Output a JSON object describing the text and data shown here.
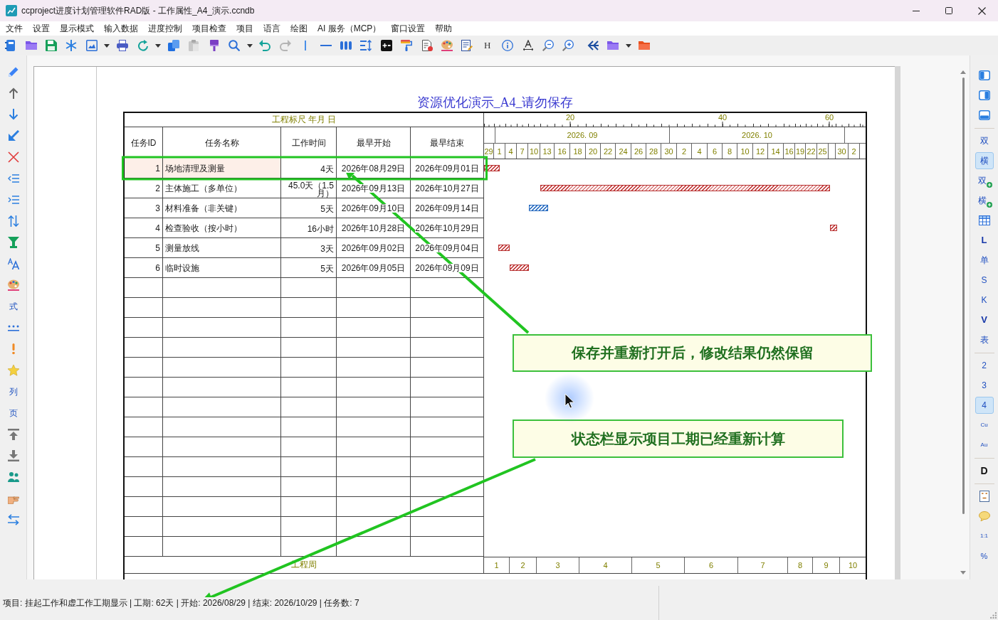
{
  "window": {
    "title": "ccproject进度计划管理软件RAD版 - 工作属性_A4_演示.ccndb"
  },
  "menu": [
    "文件",
    "设置",
    "显示模式",
    "输入数据",
    "进度控制",
    "项目检查",
    "项目",
    "语言",
    "绘图",
    "AI 服务（MCP）",
    "窗口设置",
    "帮助"
  ],
  "toolbar": {
    "glyphs": [
      "H"
    ]
  },
  "left_toolbar": {
    "glyphs": [
      "式",
      "列",
      "页"
    ]
  },
  "right_toolbar": {
    "view_buttons": [
      {
        "label": "双",
        "kind": "text",
        "selected": false
      },
      {
        "label": "横",
        "kind": "text",
        "selected": true
      },
      {
        "label": "双",
        "kind": "add",
        "selected": false
      },
      {
        "label": "横",
        "kind": "add",
        "selected": false
      }
    ],
    "style_buttons": [
      {
        "label": "L",
        "kind": "bold"
      },
      {
        "label": "单",
        "kind": "plain"
      },
      {
        "label": "S",
        "kind": "plain"
      },
      {
        "label": "K",
        "kind": "plain"
      },
      {
        "label": "V",
        "kind": "bold"
      },
      {
        "label": "表",
        "kind": "plain"
      }
    ],
    "level_buttons": [
      {
        "label": "2",
        "kind": "digit",
        "selected": false
      },
      {
        "label": "3",
        "kind": "digit",
        "selected": false
      },
      {
        "label": "4",
        "kind": "digit",
        "selected": true
      },
      {
        "label": "Cu",
        "kind": "small",
        "selected": false
      },
      {
        "label": "Au",
        "kind": "small",
        "selected": false
      }
    ],
    "d_button": "D",
    "ratio_buttons": [
      {
        "label": "1:1",
        "kind": "small"
      },
      {
        "label": "%",
        "kind": "plain"
      }
    ]
  },
  "document": {
    "title": "资源优化演示_A4_请勿保存",
    "scale_caption": "工程标尺 年月 日",
    "scale_labels": [
      "20",
      "40",
      "60"
    ],
    "months": [
      "2026. 09",
      "2026. 10"
    ],
    "days": [
      "29",
      "1",
      "4",
      "7",
      "10",
      "13",
      "16",
      "18",
      "20",
      "22",
      "24",
      "26",
      "28",
      "30",
      "2",
      "4",
      "6",
      "8",
      "10",
      "12",
      "14",
      "16",
      "19",
      "22",
      "25",
      "30",
      "2"
    ],
    "columns": [
      "任务ID",
      "任务名称",
      "工作时间",
      "最早开始",
      "最早结束"
    ],
    "rows": [
      {
        "id": "1",
        "name": "场地清理及测量",
        "duration": "4天",
        "start": "2026年08月29日",
        "finish": "2026年09月01日",
        "selected": true,
        "critical": true
      },
      {
        "id": "2",
        "name": "主体施工（多单位）",
        "duration": "45.0天（1.5月）",
        "start": "2026年09月13日",
        "finish": "2026年10月27日",
        "selected": false,
        "critical": true
      },
      {
        "id": "3",
        "name": "材料准备（非关键）",
        "duration": "5天",
        "start": "2026年09月10日",
        "finish": "2026年09月14日",
        "selected": false,
        "critical": false
      },
      {
        "id": "4",
        "name": "检查验收（按小时）",
        "duration": "16小时",
        "start": "2026年10月28日",
        "finish": "2026年10月29日",
        "selected": false,
        "critical": true
      },
      {
        "id": "5",
        "name": "测量放线",
        "duration": "3天",
        "start": "2026年09月02日",
        "finish": "2026年09月04日",
        "selected": false,
        "critical": true
      },
      {
        "id": "6",
        "name": "临时设施",
        "duration": "5天",
        "start": "2026年09月05日",
        "finish": "2026年09月09日",
        "selected": false,
        "critical": true
      }
    ],
    "footer_caption": "工程周",
    "weeks": [
      "1",
      "2",
      "3",
      "4",
      "5",
      "6",
      "7",
      "8",
      "9",
      "10"
    ]
  },
  "annotations": [
    {
      "text": "保存并重新打开后，修改结果仍然保留"
    },
    {
      "text": "状态栏显示项目工期已经重新计算"
    }
  ],
  "status_bar": {
    "text": "项目: 挂起工作和虚工作工期显示 | 工期: 62天 | 开始: 2026/08/29 | 结束: 2026/10/29 | 任务数: 7"
  }
}
